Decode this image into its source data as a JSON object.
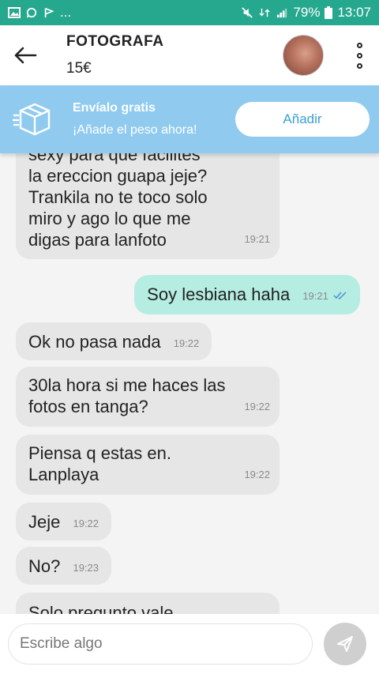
{
  "status_bar": {
    "battery": "79%",
    "time": "13:07",
    "more": "..."
  },
  "header": {
    "title": "FOTOGRAFA",
    "price": "15€"
  },
  "promo": {
    "title": "Envíalo gratis",
    "subtitle": "¡Añade el peso ahora!",
    "button": "Añadir"
  },
  "messages": [
    {
      "dir": "in",
      "lines": [
        "sexy para que facilites",
        "la ereccion guapa jeje?",
        "Trankila no te toco solo",
        "miro y ago lo que me",
        "digas para lanfoto"
      ],
      "time": "19:21"
    },
    {
      "dir": "out",
      "text": "Soy lesbiana haha",
      "time": "19:21"
    },
    {
      "dir": "in",
      "text": "Ok no pasa nada",
      "time": "19:22"
    },
    {
      "dir": "in",
      "lines": [
        "30la hora si me haces las",
        "fotos en tanga?"
      ],
      "time": "19:22"
    },
    {
      "dir": "in",
      "lines": [
        "Piensa q estas en.",
        "Lanplaya"
      ],
      "time": "19:22"
    },
    {
      "dir": "in",
      "text": "Jeje",
      "time": "19:22"
    },
    {
      "dir": "in",
      "text": "No?",
      "time": "19:23"
    },
    {
      "dir": "in",
      "text": "Solo pregunto vale"
    }
  ],
  "composer": {
    "placeholder": "Escribe algo"
  },
  "colors": {
    "status_bar": "#26a88f",
    "promo": "#90cbef",
    "outgoing": "#b6ede2",
    "incoming": "#e6e6e6"
  }
}
